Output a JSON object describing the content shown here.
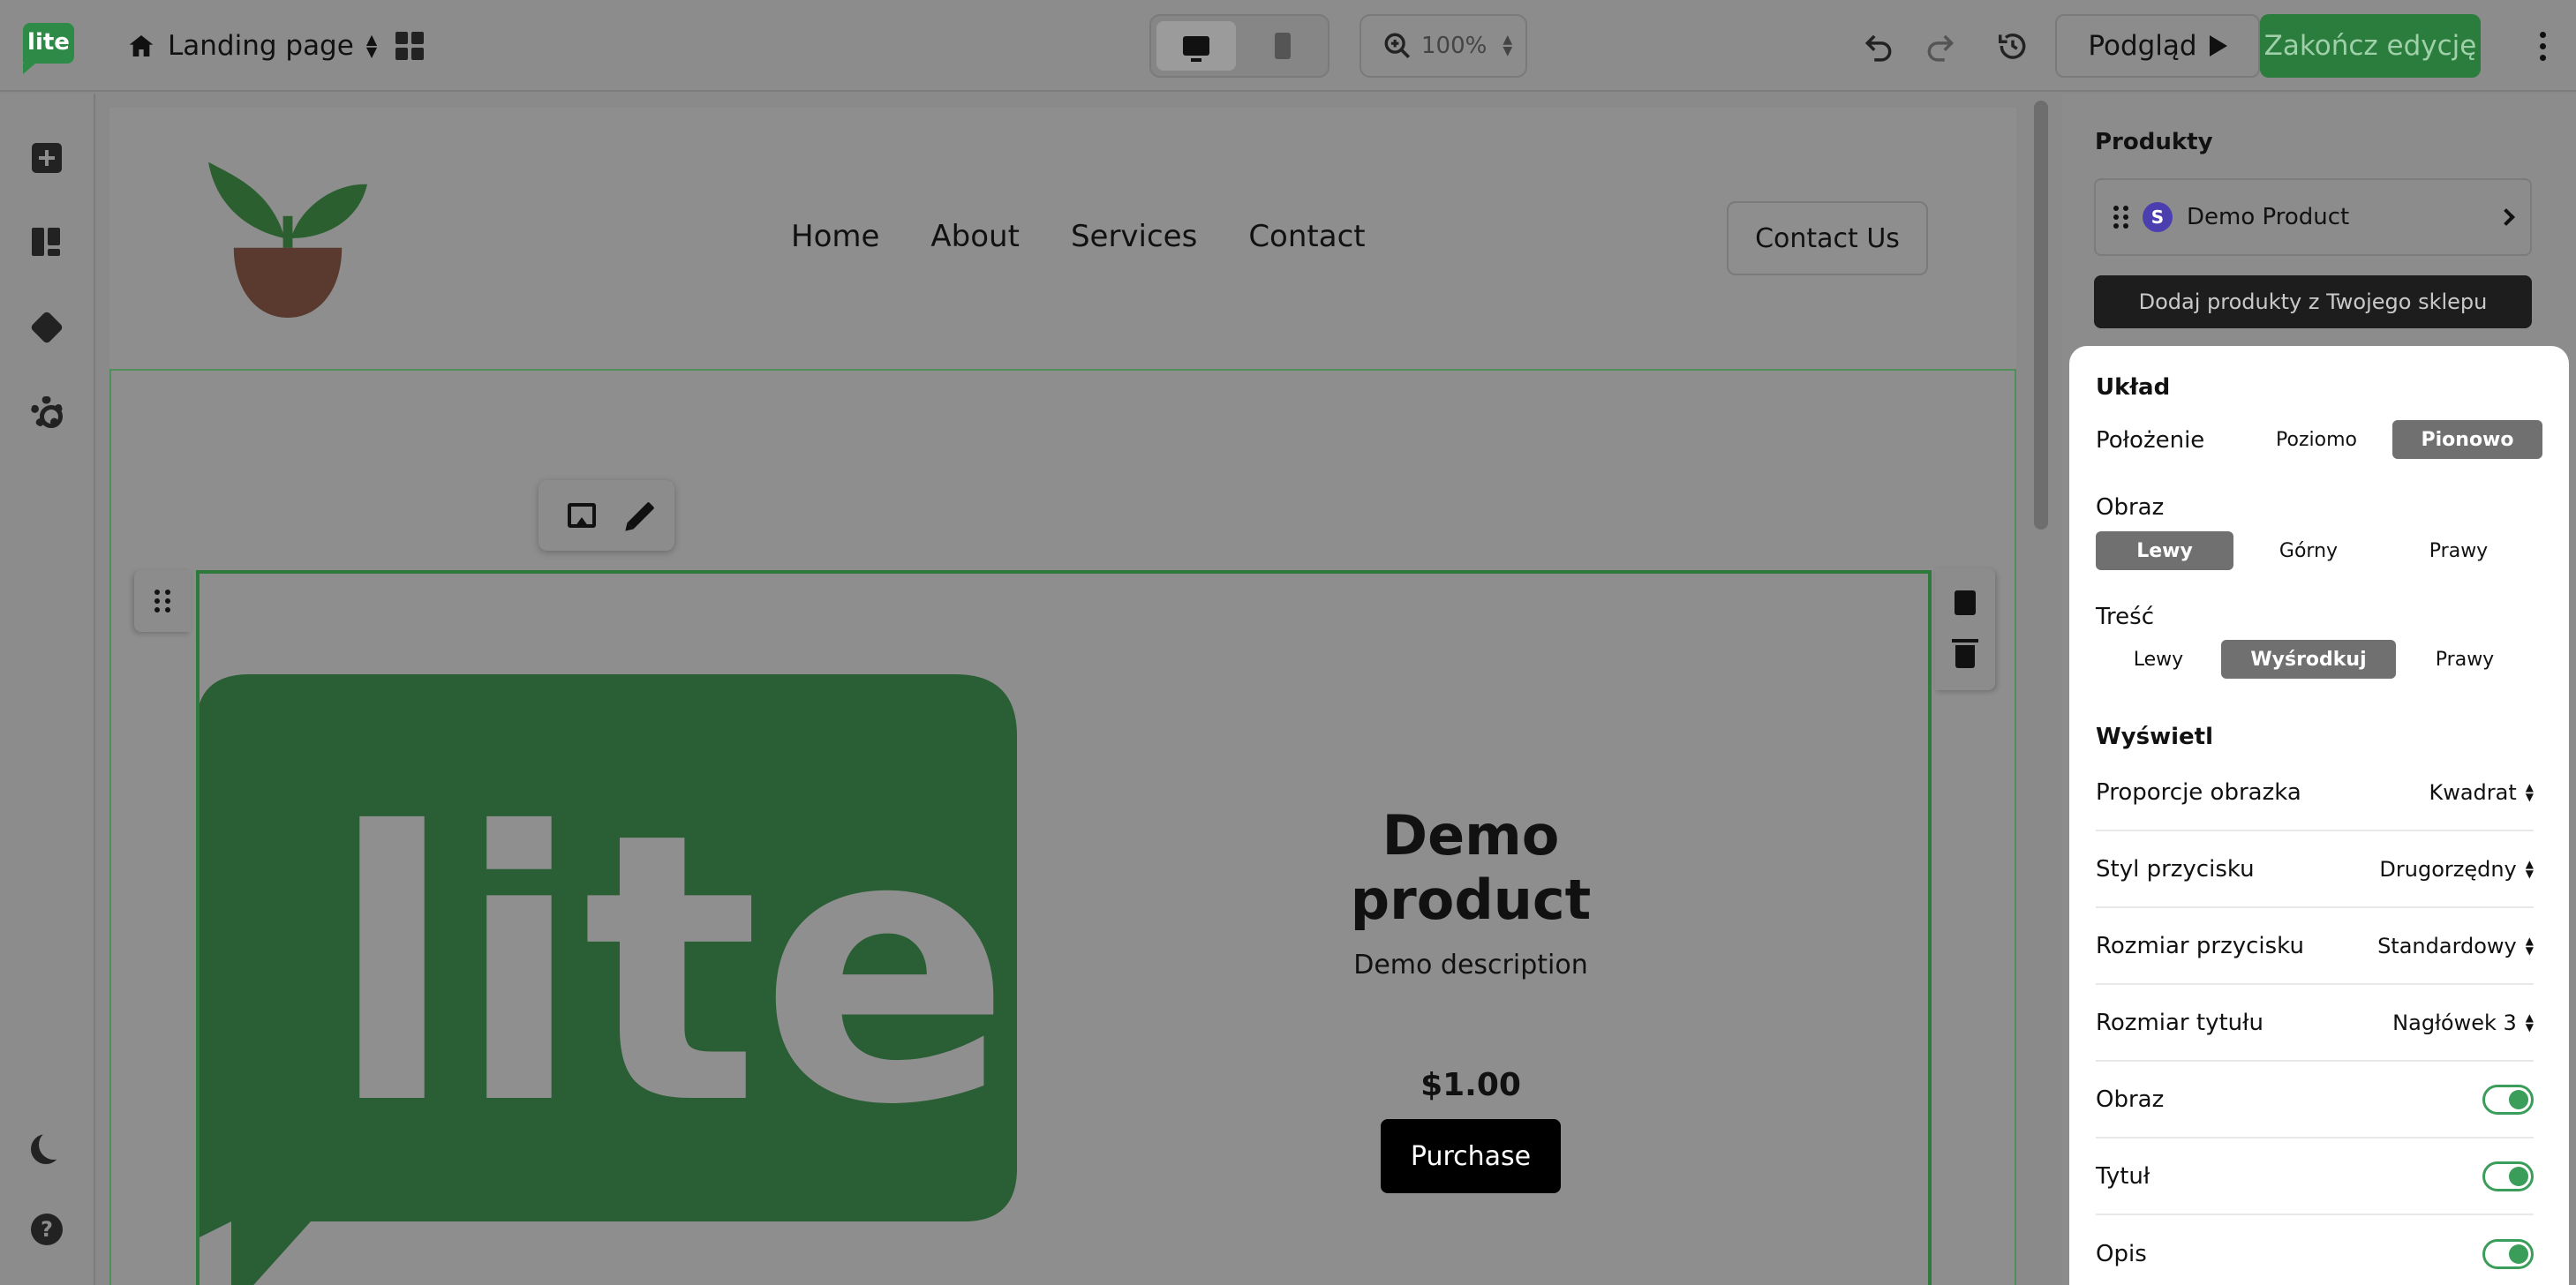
{
  "app": {
    "logo_text": "lite",
    "page_name": "Landing page",
    "zoom": "100%",
    "preview_label": "Podgląd",
    "finish_label": "Zakończ edycję",
    "brand_color": "#2e8b47"
  },
  "site": {
    "nav": [
      "Home",
      "About",
      "Services",
      "Contact"
    ],
    "cta": "Contact Us"
  },
  "product": {
    "title": "Demo product",
    "description": "Demo description",
    "price": "$1.00",
    "button": "Purchase",
    "image_text": "lite"
  },
  "panel": {
    "products_heading": "Produkty",
    "product_item": "Demo Product",
    "product_badge": "S",
    "add_products": "Dodaj produkty z Twojego sklepu",
    "layout_heading": "Układ",
    "position_label": "Położenie",
    "position_options": [
      "Poziomo",
      "Pionowo"
    ],
    "position_selected": "Pionowo",
    "image_label": "Obraz",
    "image_options": [
      "Lewy",
      "Górny",
      "Prawy"
    ],
    "image_selected": "Lewy",
    "content_label": "Treść",
    "content_options": [
      "Lewy",
      "Wyśrodkuj",
      "Prawy"
    ],
    "content_selected": "Wyśrodkuj",
    "display_heading": "Wyświetl",
    "selects": [
      {
        "label": "Proporcje obrazka",
        "value": "Kwadrat"
      },
      {
        "label": "Styl przycisku",
        "value": "Drugorzędny"
      },
      {
        "label": "Rozmiar przycisku",
        "value": "Standardowy"
      },
      {
        "label": "Rozmiar tytułu",
        "value": "Nagłówek 3"
      }
    ],
    "toggles": [
      {
        "label": "Obraz",
        "on": true
      },
      {
        "label": "Tytuł",
        "on": true
      },
      {
        "label": "Opis",
        "on": true
      }
    ]
  }
}
